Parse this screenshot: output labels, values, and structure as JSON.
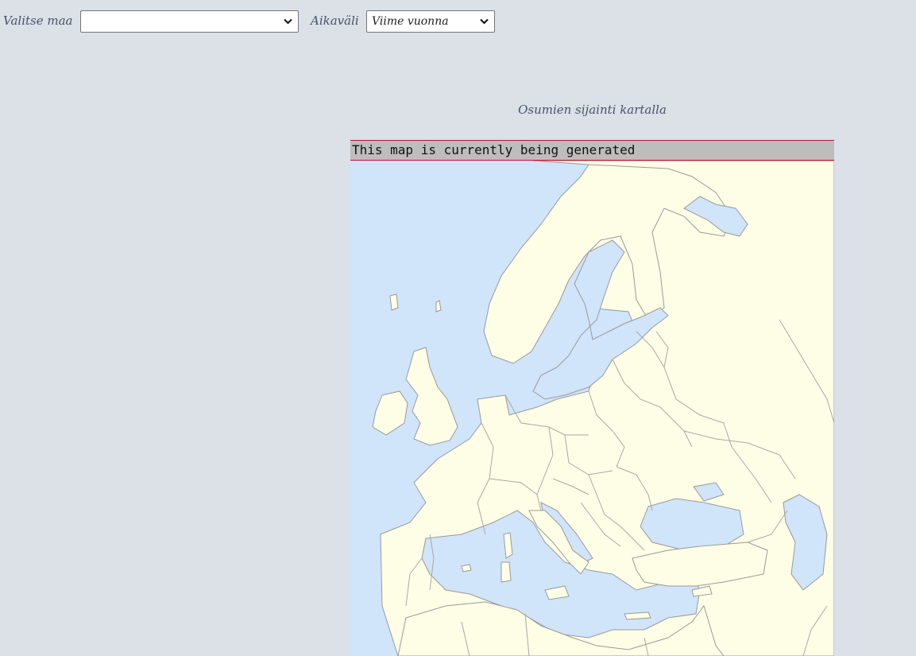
{
  "controls": {
    "country_label": "Valitse maa",
    "country_value": "",
    "period_label": "Aikaväli",
    "period_value": "Viime vuonna"
  },
  "map": {
    "title": "Osumien sijainti kartalla",
    "status_banner": "This map is currently being generated",
    "colors": {
      "sea": "#d0e4fa",
      "land": "#fefee6",
      "banner_bg": "#bdbdbd",
      "banner_border": "#c8102e"
    }
  }
}
